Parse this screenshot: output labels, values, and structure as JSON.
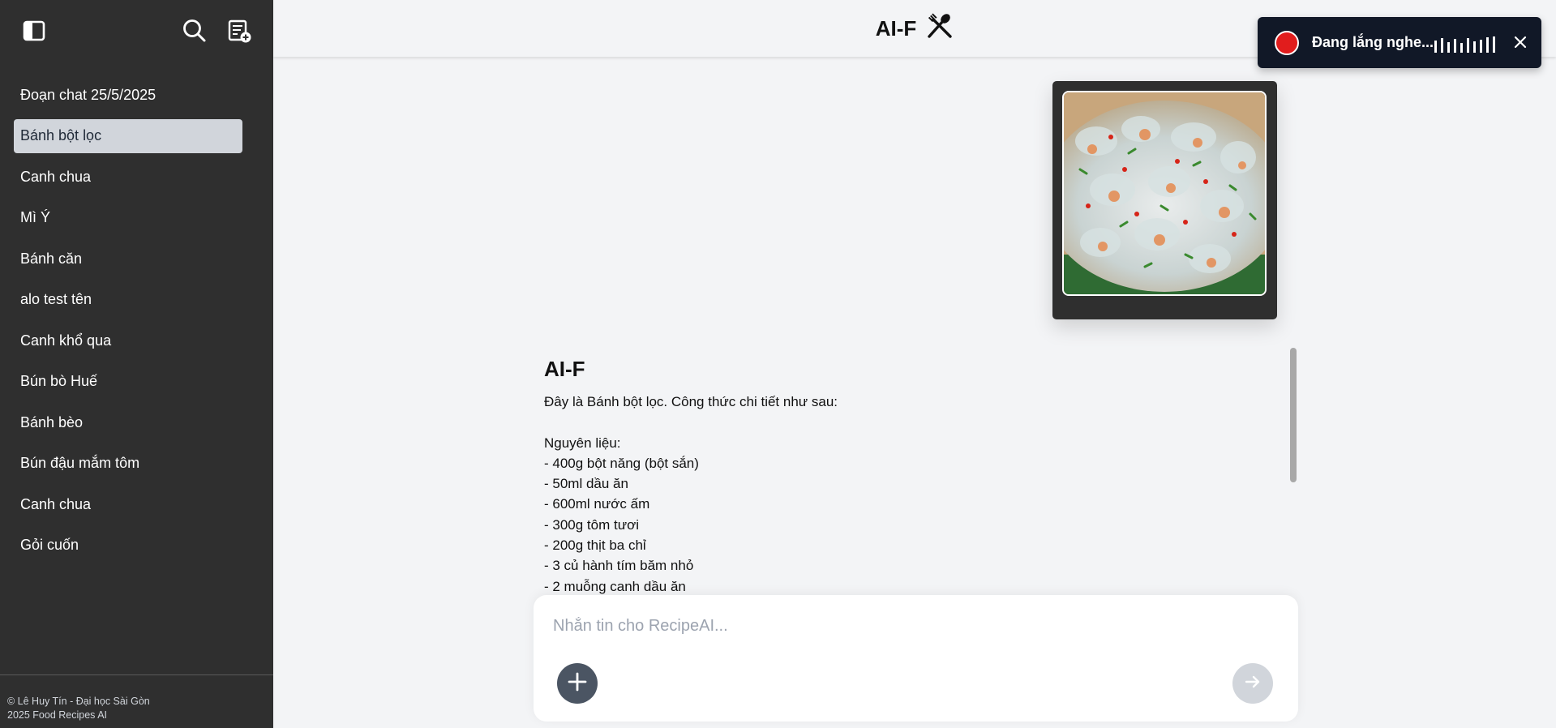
{
  "sidebar": {
    "items": [
      {
        "label": "Đoạn chat 25/5/2025",
        "active": false
      },
      {
        "label": "Bánh bột lọc",
        "active": true
      },
      {
        "label": "Canh chua",
        "active": false
      },
      {
        "label": "Mì Ý",
        "active": false
      },
      {
        "label": "Bánh căn",
        "active": false
      },
      {
        "label": "alo test tên",
        "active": false
      },
      {
        "label": "Canh khổ qua",
        "active": false
      },
      {
        "label": "Bún bò Huế",
        "active": false
      },
      {
        "label": "Bánh bèo",
        "active": false
      },
      {
        "label": "Bún đậu mắm tôm",
        "active": false
      },
      {
        "label": "Canh chua",
        "active": false
      },
      {
        "label": "Gỏi cuốn",
        "active": false
      }
    ],
    "footer_line1": "© Lê Huy Tín - Đại học Sài Gòn",
    "footer_line2": "2025 Food Recipes AI"
  },
  "header": {
    "title": "AI-F",
    "icon": "fork-spoon-icon"
  },
  "message": {
    "ai_name": "AI-F",
    "lines": [
      "Đây là Bánh bột lọc. Công thức chi tiết như sau:",
      "",
      "Nguyên liệu:",
      "- 400g bột năng (bột sắn)",
      "- 50ml dầu ăn",
      "- 600ml nước ấm",
      "- 300g tôm tươi",
      "- 200g thịt ba chỉ",
      "- 3 củ hành tím băm nhỏ",
      "- 2 muỗng canh dầu ăn"
    ]
  },
  "composer": {
    "placeholder": "Nhắn tin cho RecipeAI..."
  },
  "toast": {
    "text": "Đang lắng nghe...",
    "levels": [
      0.75,
      0.9,
      0.65,
      0.85,
      0.6,
      0.9,
      0.7,
      0.8,
      0.95,
      1.0
    ]
  },
  "colors": {
    "sidebar_bg": "#2f2f2f",
    "active_item_bg": "#d1d5db",
    "record": "#e11d1d",
    "toast_bg": "#111827"
  }
}
